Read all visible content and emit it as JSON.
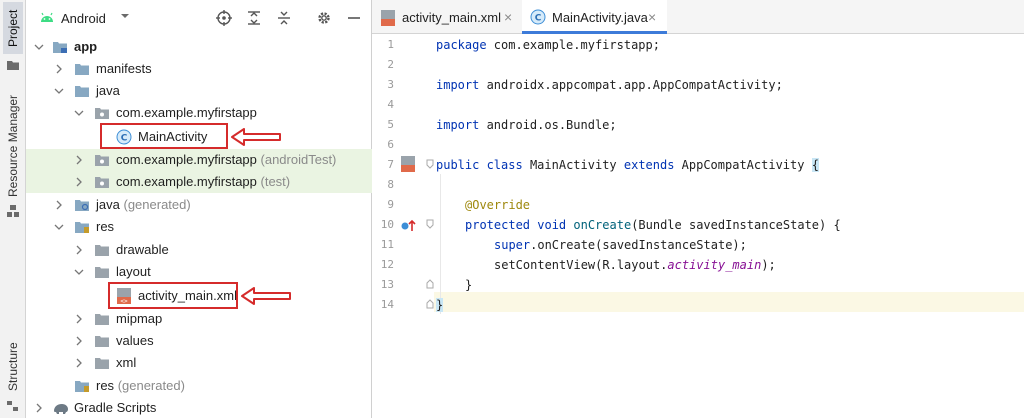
{
  "side_strip": {
    "project_tab": "Project",
    "resource_manager_tab": "Resource Manager",
    "structure_tab": "Structure"
  },
  "project_panel": {
    "view_mode": "Android",
    "tree": {
      "app": "app",
      "manifests": "manifests",
      "java": "java",
      "pkg_main": "com.example.myfirstapp",
      "main_activity": "MainActivity",
      "pkg_android_test": "com.example.myfirstapp",
      "android_test_suffix": "(androidTest)",
      "pkg_test": "com.example.myfirstapp",
      "test_suffix": "(test)",
      "java_generated": "java",
      "java_generated_suffix": "(generated)",
      "res": "res",
      "drawable": "drawable",
      "layout": "layout",
      "activity_main_xml": "activity_main.xml",
      "mipmap": "mipmap",
      "values": "values",
      "xml": "xml",
      "res_generated": "res",
      "res_generated_suffix": "(generated)",
      "gradle_scripts": "Gradle Scripts"
    }
  },
  "editor": {
    "tabs": [
      {
        "label": "activity_main.xml",
        "active": false
      },
      {
        "label": "MainActivity.java",
        "active": true
      }
    ],
    "close_glyph": "×",
    "lines": [
      {
        "n": "1",
        "text": "package com.example.myfirstapp;"
      },
      {
        "n": "2",
        "text": ""
      },
      {
        "n": "3",
        "text": "import androidx.appcompat.app.AppCompatActivity;"
      },
      {
        "n": "4",
        "text": ""
      },
      {
        "n": "5",
        "text": "import android.os.Bundle;"
      },
      {
        "n": "6",
        "text": ""
      },
      {
        "n": "7",
        "text": "public class MainActivity extends AppCompatActivity {"
      },
      {
        "n": "8",
        "text": ""
      },
      {
        "n": "9",
        "text": "@Override"
      },
      {
        "n": "10",
        "text": "protected void onCreate(Bundle savedInstanceState) {"
      },
      {
        "n": "11",
        "text": "super.onCreate(savedInstanceState);"
      },
      {
        "n": "12",
        "text": "setContentView(R.layout.activity_main);"
      },
      {
        "n": "13",
        "text": "}"
      },
      {
        "n": "14",
        "text": "}"
      }
    ],
    "tokens": {
      "package_kw": "package",
      "package_name": " com.example.myfirstapp;",
      "import_kw": "import",
      "import1": " androidx.appcompat.app.AppCompatActivity;",
      "import2": " android.os.Bundle;",
      "public_kw": "public",
      "class_kw": " class",
      "class_name": " MainActivity",
      "extends_kw": " extends",
      "super_name": " AppCompatActivity ",
      "open_brace": "{",
      "override": "@Override",
      "protected_kw": "protected",
      "void_kw": " void",
      "method": " onCreate",
      "params": "(Bundle savedInstanceState) {",
      "super_kw": "super",
      "super_call": ".onCreate(savedInstanceState);",
      "set_cv": "setContentView(R.layout.",
      "layout_name": "activity_main",
      "set_cv_end": ");",
      "close_inner": "}",
      "close_outer": "}"
    }
  },
  "colors": {
    "highlight_red": "#d52b2b",
    "keyword_blue": "#0033b3",
    "annotation": "#9e880d",
    "test_row_bg": "#eaf4e2",
    "active_tab_underline": "#3d7bd9"
  }
}
